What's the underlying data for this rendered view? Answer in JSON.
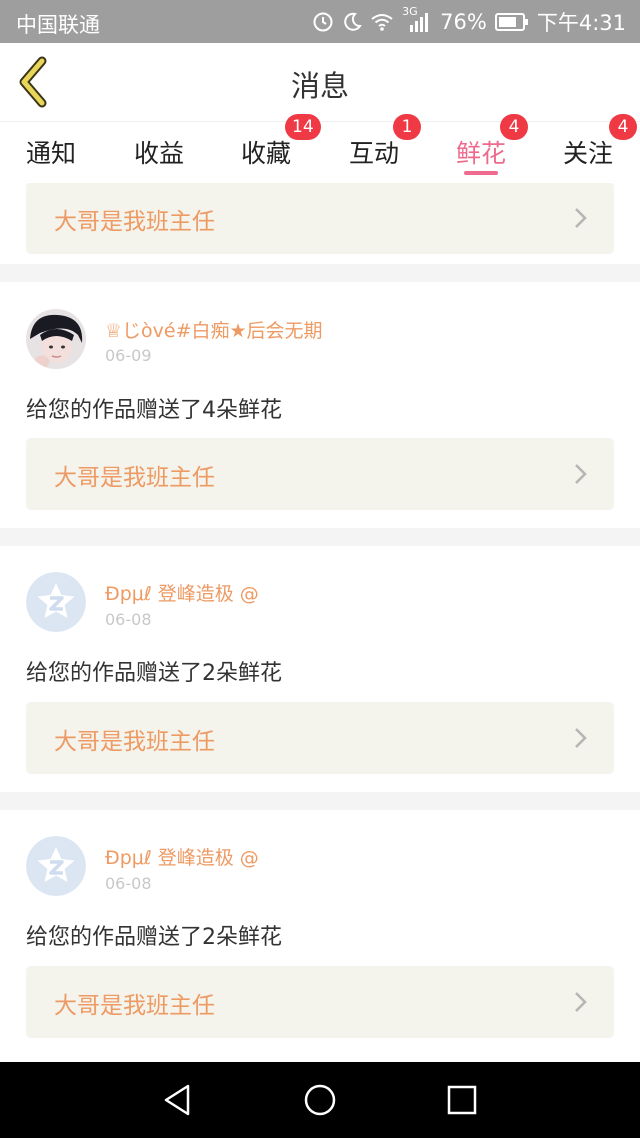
{
  "status": {
    "carrier": "中国联通",
    "network": "3G",
    "battery": "76%",
    "time": "下午4:31",
    "icons": [
      "alarm-icon",
      "moon-icon",
      "wifi-icon",
      "signal-icon",
      "battery-icon"
    ]
  },
  "header": {
    "title": "消息",
    "back_icon": "chevron-left-icon"
  },
  "tabs": [
    {
      "label": "通知",
      "badge": "",
      "active": false
    },
    {
      "label": "收益",
      "badge": "",
      "active": false
    },
    {
      "label": "收藏",
      "badge": "14",
      "active": false
    },
    {
      "label": "互动",
      "badge": "1",
      "active": false
    },
    {
      "label": "鲜花",
      "badge": "4",
      "active": true
    },
    {
      "label": "关注",
      "badge": "4",
      "active": false
    }
  ],
  "partial_top": {
    "link_text": "大哥是我班主任"
  },
  "items": [
    {
      "username": "♕じòvé#白痴★后会无期",
      "date": "06-09",
      "message": "给您的作品赠送了4朵鲜花",
      "link_text": "大哥是我班主任",
      "avatar": "photo"
    },
    {
      "username": "Ðpμℓ 登峰造极 @",
      "date": "06-08",
      "message": "给您的作品赠送了2朵鲜花",
      "link_text": "大哥是我班主任",
      "avatar": "default"
    },
    {
      "username": "Ðpμℓ 登峰造极 @",
      "date": "06-08",
      "message": "给您的作品赠送了2朵鲜花",
      "link_text": "大哥是我班主任",
      "avatar": "default"
    }
  ],
  "nav": {
    "icons": [
      "back-triangle-icon",
      "home-circle-icon",
      "recents-square-icon"
    ]
  },
  "colors": {
    "accent": "#ef6b8e",
    "badge": "#ef3a46",
    "username": "#ee9a63",
    "link_bg": "#f4f3ec"
  }
}
